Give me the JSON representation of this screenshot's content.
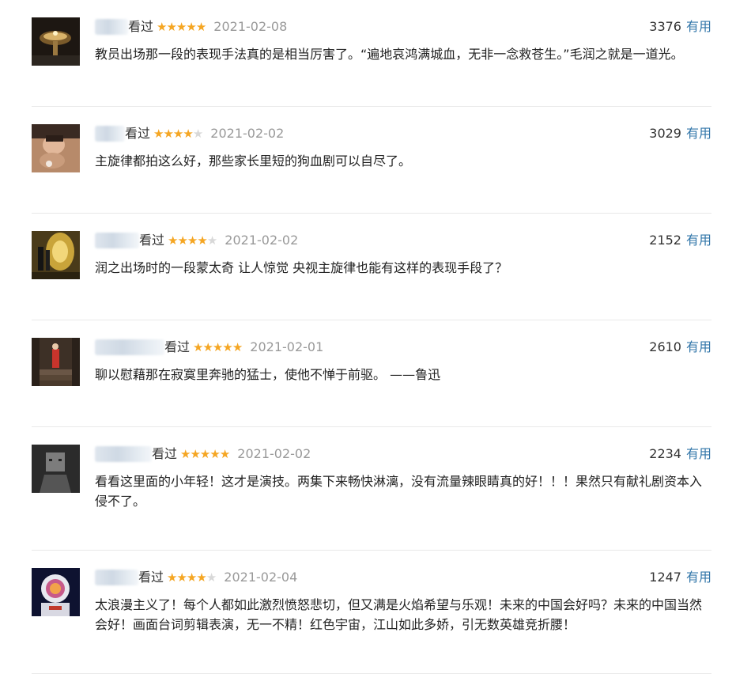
{
  "comments": [
    {
      "status": "看过",
      "rating": 5,
      "date": "2021-02-08",
      "votes": "3376",
      "useful": "有用",
      "text": "教员出场那一段的表现手法真的是相当厉害了。“遍地哀鸿满城血，无非一念救苍生。”毛润之就是一道光。",
      "avatar_icon": "golden-chandelier-icon"
    },
    {
      "status": "看过",
      "rating": 4,
      "date": "2021-02-02",
      "votes": "3029",
      "useful": "有用",
      "text": "主旋律都拍这么好，那些家长里短的狗血剧可以自尽了。",
      "avatar_icon": "person-photo-icon"
    },
    {
      "status": "看过",
      "rating": 4,
      "date": "2021-02-02",
      "votes": "2152",
      "useful": "有用",
      "text": "润之出场时的一段蒙太奇 让人惊觉 央视主旋律也能有这样的表现手段了？",
      "avatar_icon": "tunnel-figures-icon"
    },
    {
      "status": "看过",
      "rating": 5,
      "date": "2021-02-01",
      "votes": "2610",
      "useful": "有用",
      "text": "聊以慰藉那在寂寞里奔驰的猛士，使他不惮于前驱。 ——鲁迅",
      "avatar_icon": "stairs-figure-icon"
    },
    {
      "status": "看过",
      "rating": 5,
      "date": "2021-02-02",
      "votes": "2234",
      "useful": "有用",
      "text": "看看这里面的小年轻！这才是演技。两集下来畅快淋漓，没有流量辣眼睛真的好！！！果然只有献礼剧资本入侵不了。",
      "avatar_icon": "box-head-icon"
    },
    {
      "status": "看过",
      "rating": 4,
      "date": "2021-02-04",
      "votes": "1247",
      "useful": "有用",
      "text": "太浪漫主义了！每个人都如此激烈愤怒悲切，但又满是火焰希望与乐观！未来的中国会好吗？未来的中国当然会好！画面台词剪辑表演，无一不精！红色宇宙，江山如此多娇，引无数英雄竞折腰！",
      "avatar_icon": "astronaut-icon"
    }
  ],
  "colors": {
    "star": "#f5a623",
    "useful_link": "#3377aa",
    "date": "#999999",
    "divider": "#e9e9e9"
  }
}
